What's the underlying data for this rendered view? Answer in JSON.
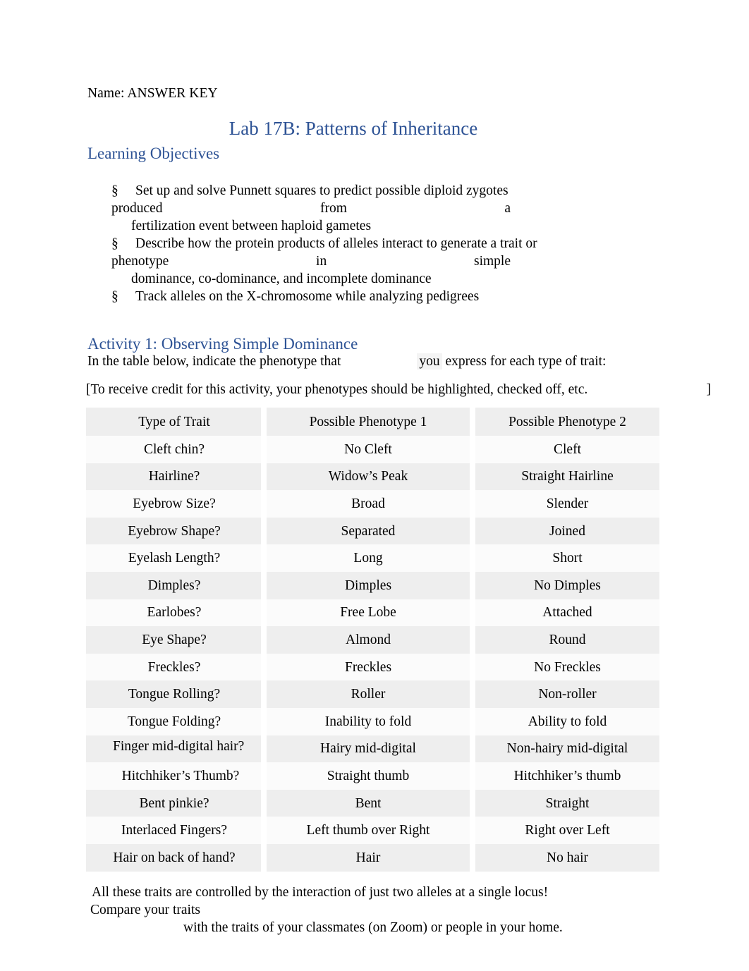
{
  "document": {
    "name_line": "Name: ANSWER KEY",
    "title": "Lab 17B: Patterns of Inheritance"
  },
  "learning_objectives": {
    "heading": "Learning Objectives",
    "bullet_glyph": "§",
    "items": [
      {
        "line1": "Set up and solve Punnett squares to predict possible diploid zygotes",
        "wrap_words": [
          "produced",
          "from",
          "a"
        ],
        "line3": "fertilization event between haploid gametes"
      },
      {
        "line1": "Describe how the protein products of alleles interact to generate a trait or",
        "wrap_words": [
          "phenotype",
          "in",
          "simple"
        ],
        "line3": "dominance, co-dominance, and incomplete dominance"
      },
      {
        "line1": "Track alleles on the X-chromosome while analyzing pedigrees"
      }
    ]
  },
  "activity1": {
    "heading": "Activity 1: Observing Simple Dominance",
    "instruction_part1": "In the table below, indicate the phenotype that",
    "instruction_highlight": "you",
    "instruction_part2": "express for each type of trait:",
    "credit_note": "[To receive credit for this activity, your phenotypes should be highlighted, checked off, etc.",
    "credit_note_close": "]"
  },
  "trait_table": {
    "columns": [
      "Type of Trait",
      "Possible Phenotype 1",
      "Possible Phenotype 2"
    ],
    "rows": [
      [
        "Cleft chin?",
        "No Cleft",
        "Cleft"
      ],
      [
        "Hairline?",
        "Widow’s Peak",
        "Straight Hairline"
      ],
      [
        "Eyebrow Size?",
        "Broad",
        "Slender"
      ],
      [
        "Eyebrow Shape?",
        "Separated",
        "Joined"
      ],
      [
        "Eyelash Length?",
        "Long",
        "Short"
      ],
      [
        "Dimples?",
        "Dimples",
        "No Dimples"
      ],
      [
        "Earlobes?",
        "Free Lobe",
        "Attached"
      ],
      [
        "Eye Shape?",
        "Almond",
        "Round"
      ],
      [
        "Freckles?",
        "Freckles",
        "No Freckles"
      ],
      [
        "Tongue Rolling?",
        "Roller",
        "Non-roller"
      ],
      [
        "Tongue Folding?",
        "Inability to fold",
        "Ability to fold"
      ],
      [
        "Finger mid-digital hair?",
        "Hairy mid-digital",
        "Non-hairy mid-digital"
      ],
      [
        "Hitchhiker’s Thumb?",
        "Straight thumb",
        "Hitchhiker’s thumb"
      ],
      [
        "Bent pinkie?",
        "Bent",
        "Straight"
      ],
      [
        "Interlaced Fingers?",
        "Left thumb over Right",
        "Right over Left"
      ],
      [
        "Hair on back of hand?",
        "Hair",
        "No hair"
      ]
    ]
  },
  "footer": {
    "line1": "All these traits are controlled by the interaction of just two alleles at a single locus!",
    "line2": "Compare your traits",
    "line3": "with the traits of your classmates (on Zoom) or people in your home."
  },
  "colors": {
    "heading_blue": "#2e5395",
    "row_band": "#eeeeee",
    "row_plain": "#fbfbfb",
    "text": "#000000"
  }
}
